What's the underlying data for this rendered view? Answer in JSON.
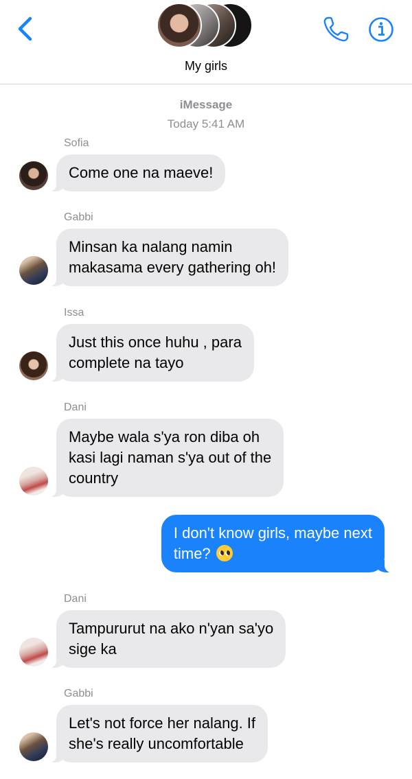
{
  "header": {
    "back_icon": "chevron-left-icon",
    "group_name": "My girls",
    "phone_icon": "phone-icon",
    "info_icon": "info-icon",
    "accent_color": "#1a82fb"
  },
  "conversation": {
    "service": "iMessage",
    "timestamp": "Today 5:41 AM"
  },
  "messages": [
    {
      "sender": "Sofia",
      "text": "Come one na maeve!",
      "direction": "incoming"
    },
    {
      "sender": "Gabbi",
      "text": "Minsan ka nalang namin\nmakasama every gathering oh!",
      "direction": "incoming"
    },
    {
      "sender": "Issa",
      "text": "Just this once huhu , para\ncomplete na tayo",
      "direction": "incoming"
    },
    {
      "sender": "Dani",
      "text": "Maybe wala s'ya ron diba oh\nkasi lagi naman s'ya out of the\ncountry",
      "direction": "incoming"
    },
    {
      "sender": "",
      "text": "I don't know girls, maybe next\ntime?",
      "emoji": "pleading-face-emoji",
      "direction": "outgoing"
    },
    {
      "sender": "Dani",
      "text": "Tampururut na ako n'yan sa'yo\nsige ka",
      "direction": "incoming"
    },
    {
      "sender": "Gabbi",
      "text": "Let's not force her nalang. If\nshe's really uncomfortable",
      "direction": "incoming"
    }
  ],
  "colors": {
    "incoming_bubble": "#e9e9eb",
    "outgoing_bubble": "#1a82fb",
    "meta_text": "#8e8e93"
  }
}
